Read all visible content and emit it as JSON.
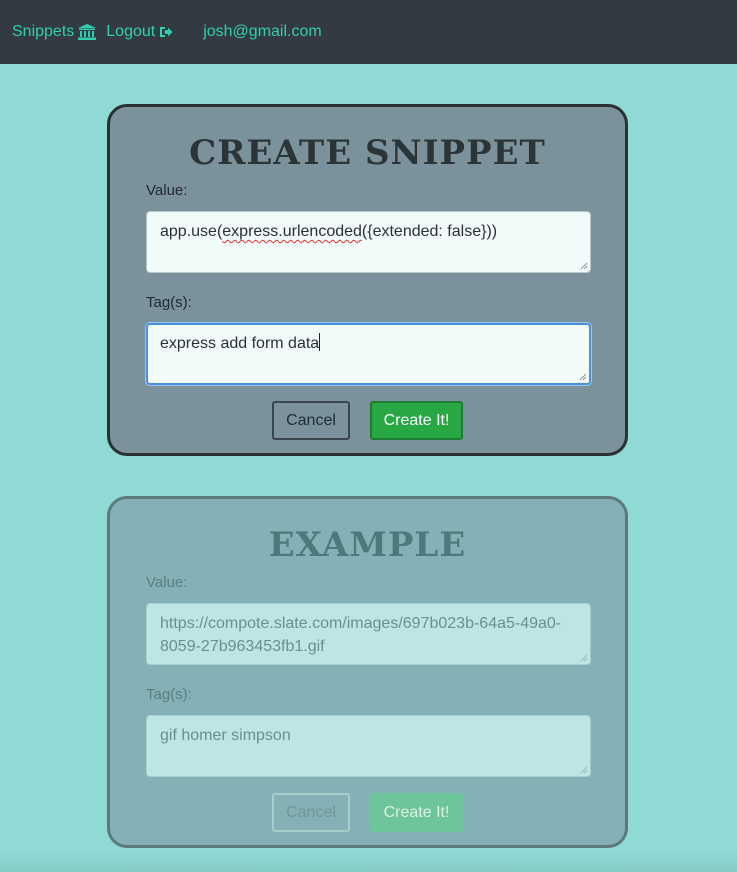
{
  "nav": {
    "snippets_label": "Snippets",
    "logout_label": "Logout",
    "email": "josh@gmail.com",
    "link_color": "#2ed0b0",
    "bg_color": "#343a41"
  },
  "create_form": {
    "title": "CREATE SNIPPET",
    "value_label": "Value:",
    "value_parts": {
      "before": "app.use(",
      "misspelled": "express.urlencoded",
      "after": "({extended: false}))"
    },
    "tags_label": "Tag(s):",
    "tags_value": "express add form data",
    "cancel_label": "Cancel",
    "submit_label": "Create It!"
  },
  "example_form": {
    "title": "EXAMPLE",
    "value_label": "Value:",
    "value_text": "https://compote.slate.com/images/697b023b-64a5-49a0-8059-27b963453fb1.gif",
    "tags_label": "Tag(s):",
    "tags_value": "gif homer simpson",
    "cancel_label": "Cancel",
    "submit_label": "Create It!"
  },
  "colors": {
    "page_bg": "#8fdad5",
    "create_card_bg": "#7b929c",
    "example_card_bg": "#84b1b6",
    "submit_green": "#28a745"
  },
  "icons": {
    "snippets": "bank-icon",
    "logout": "sign-out-icon"
  }
}
